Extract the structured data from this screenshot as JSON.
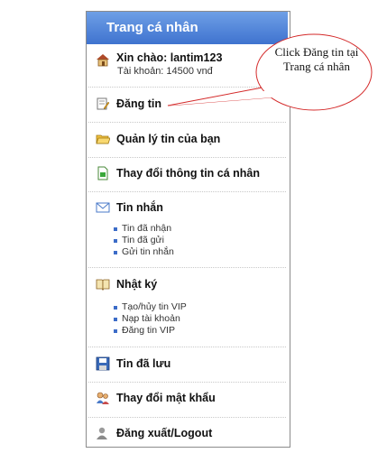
{
  "panel": {
    "header": "Trang cá nhân",
    "greeting": "Xin chào: lantim123",
    "account": "Tài khoản: 14500 vnđ",
    "items": {
      "dang_tin": "Đăng tin",
      "quan_ly": "Quản lý tin của bạn",
      "thay_doi_thong_tin": "Thay đổi thông tin cá nhân",
      "tin_nhan": "Tin nhắn",
      "nhat_ky": "Nhật ký",
      "tin_da_luu": "Tin đã lưu",
      "mat_khau": "Thay đổi mật khẩu",
      "logout": "Đăng xuất/Logout"
    },
    "tin_nhan_sub": [
      "Tin đã nhận",
      "Tin đã gửi",
      "Gửi tin nhắn"
    ],
    "nhat_ky_sub": [
      "Tạo/hủy tin VIP",
      "Nạp tài khoản",
      "Đăng tin VIP"
    ]
  },
  "callout": {
    "text": "Click Đăng tin tại Trang cá nhân"
  },
  "colors": {
    "header_top": "#6e9fe6",
    "header_bottom": "#3f73cf",
    "callout_border": "#d42a2a"
  }
}
